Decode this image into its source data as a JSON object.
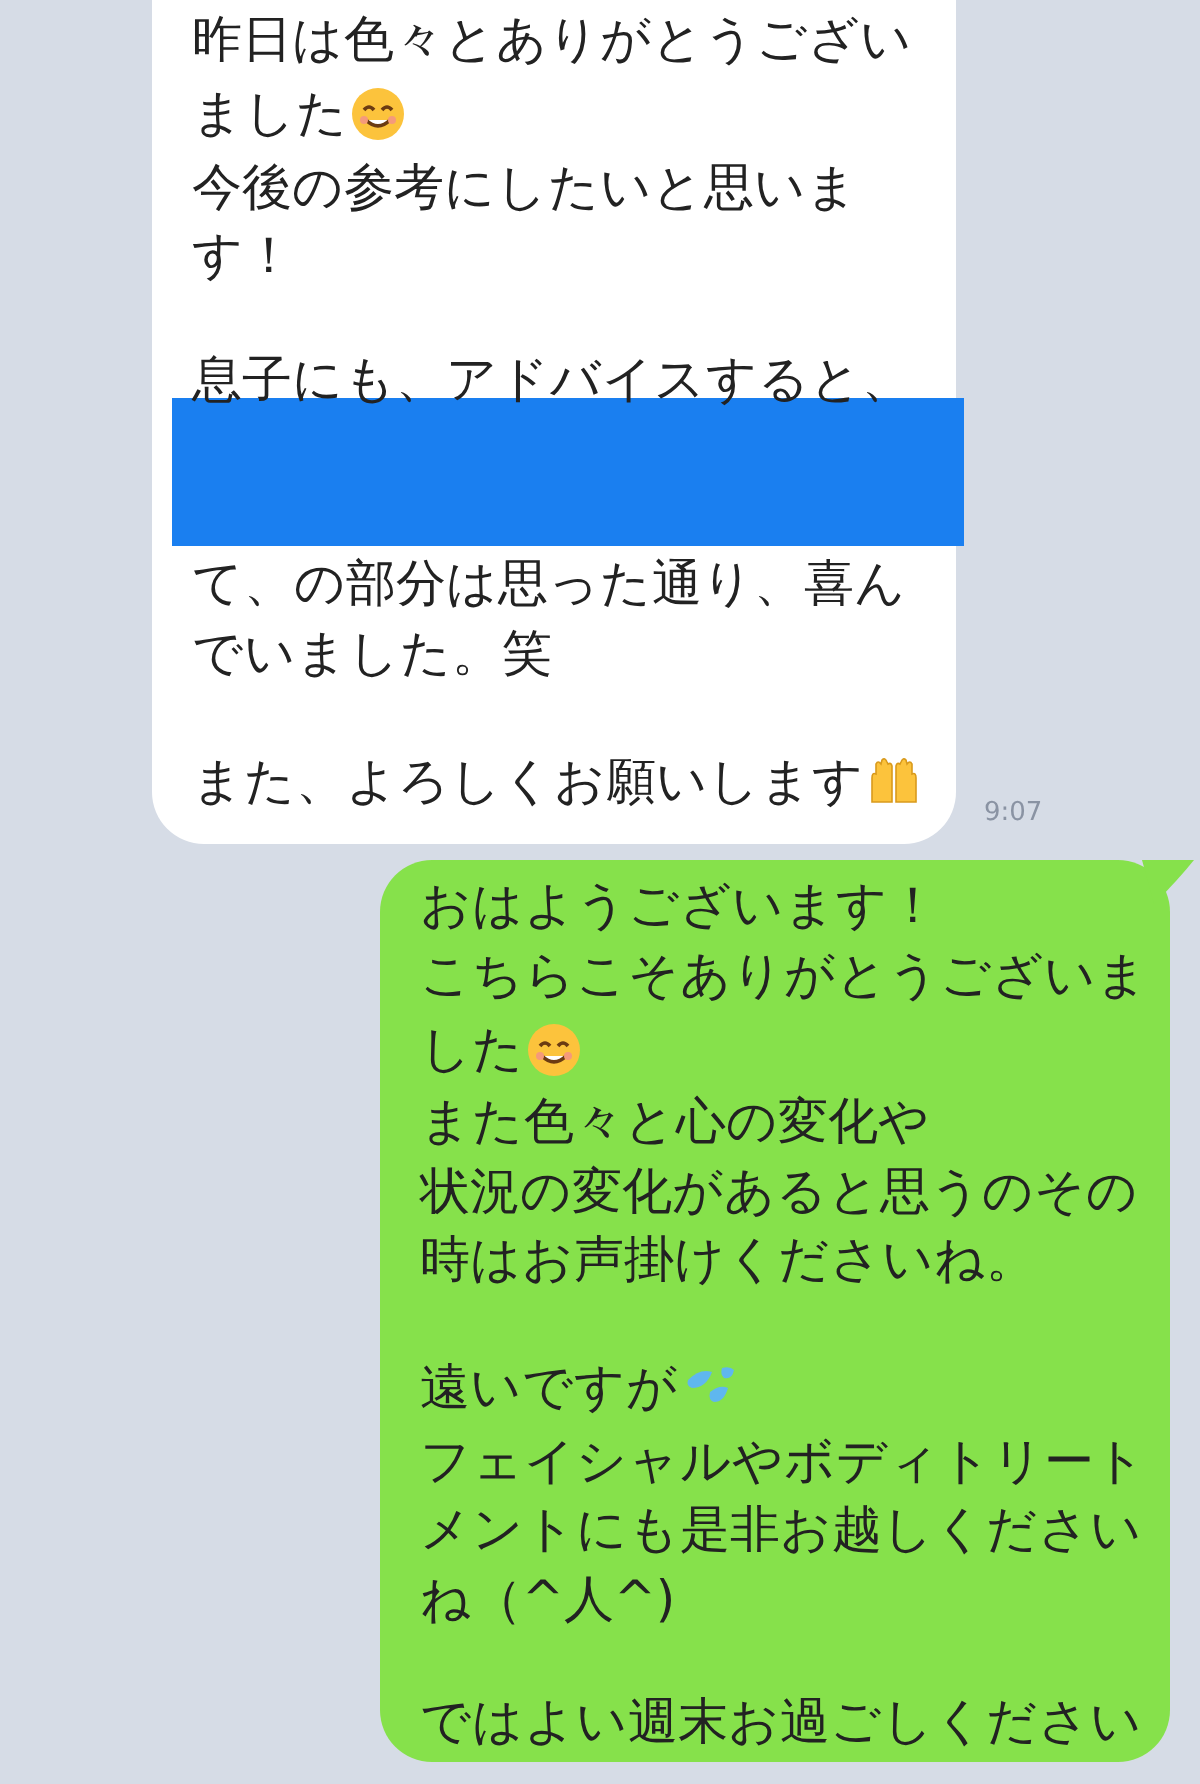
{
  "messages": [
    {
      "kind": "received",
      "time": "9:07",
      "paragraphs": [
        [
          {
            "kind": "text",
            "text": "昨日は色々とありがとうござい"
          },
          {
            "kind": "text",
            "text": "ました",
            "emoji": {
              "kind": "smile"
            }
          },
          {
            "kind": "text",
            "text": "今後の参考にしたいと思いま"
          },
          {
            "kind": "text",
            "text": "す！"
          }
        ],
        [
          {
            "kind": "text",
            "text": "息子にも、アドバイスすると、"
          },
          {
            "kind": "redacted"
          },
          {
            "kind": "text",
            "text": "て、の部分は思った通り、喜ん"
          },
          {
            "kind": "text",
            "text": "でいました。笑"
          }
        ],
        [
          {
            "kind": "text",
            "text": "また、よろしくお願いします",
            "emoji": {
              "kind": "hands"
            }
          }
        ]
      ]
    },
    {
      "kind": "sent",
      "paragraphs": [
        [
          {
            "kind": "text",
            "text": "おはようございます！"
          },
          {
            "kind": "text",
            "text": "こちらこそありがとうございま"
          },
          {
            "kind": "text",
            "text": "した",
            "emoji": {
              "kind": "smile"
            }
          },
          {
            "kind": "text",
            "text": "また色々と心の変化や"
          },
          {
            "kind": "text",
            "text": "状況の変化があると思うのその"
          },
          {
            "kind": "text",
            "text": "時はお声掛けくださいね。"
          }
        ],
        [
          {
            "kind": "text",
            "text": "遠いですが",
            "emoji": {
              "kind": "sweat"
            }
          },
          {
            "kind": "text",
            "text": "フェイシャルやボディトリート"
          },
          {
            "kind": "text",
            "text": "メントにも是非お越しください"
          },
          {
            "kind": "text",
            "text": "ね（^人^)"
          }
        ],
        [
          {
            "kind": "text",
            "text": "ではよい週末お過ごしください"
          }
        ]
      ]
    }
  ]
}
